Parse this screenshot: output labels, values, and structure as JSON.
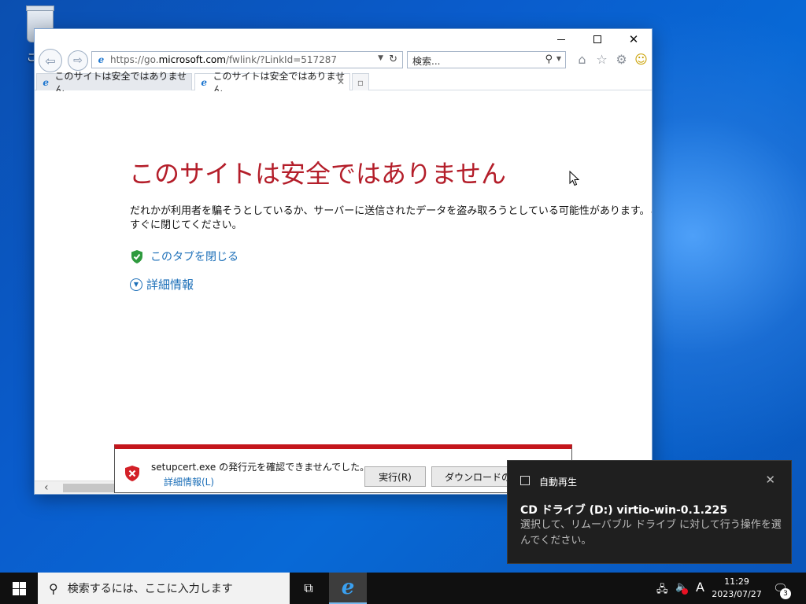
{
  "desktop": {
    "recycle_label": "こ"
  },
  "browser": {
    "address_url_prefix": "https://go.",
    "address_url_host": "microsoft.com",
    "address_url_path": "/fwlink/?LinkId=517287",
    "search_placeholder": "検索...",
    "tabs": [
      {
        "label": "このサイトは安全ではありません"
      },
      {
        "label": "このサイトは安全ではありません"
      }
    ]
  },
  "page": {
    "title": "このサイトは安全ではありません",
    "body_line1": "だれかが利用者を騙そうとしているか、サーバーに送信されたデータを盗み取ろうとしている可能性があります。このサイ",
    "body_line2": "すぐに閉じてください。",
    "close_tab_label": "このタブを閉じる",
    "more_info_label": "詳細情報"
  },
  "download_bar": {
    "message": "setupcert.exe の発行元を確認できませんでした。",
    "details_link": "詳細情報(L)",
    "run_button": "実行(R)",
    "view_downloads_button": "ダウンロードの表示(V)"
  },
  "toast": {
    "app": "自動再生",
    "title": "CD ドライブ (D:) virtio-win-0.1.225",
    "body": "選択して、リムーバブル ドライブ に対して行う操作を選んでください。"
  },
  "taskbar": {
    "search_placeholder": "検索するには、ここに入力します",
    "ime": "A",
    "time": "11:29",
    "date": "2023/07/27",
    "notification_count": "3"
  },
  "colors": {
    "warning_red": "#b41e2a",
    "link_blue": "#1c6fb8",
    "alert_bar_red": "#c4161c"
  }
}
